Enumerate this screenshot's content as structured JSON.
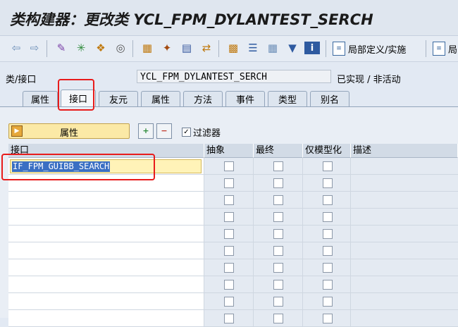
{
  "title": "类构建器：更改类 YCL_FPM_DYLANTEST_SERCH",
  "toolbar": {
    "local_def_label": "局部定义/实施",
    "local_label2": "局"
  },
  "fields": {
    "label": "类/接口",
    "value": "YCL_FPM_DYLANTEST_SERCH",
    "status": "已实现 / 非活动"
  },
  "tabs": [
    "属性",
    "接口",
    "友元",
    "属性",
    "方法",
    "事件",
    "类型",
    "别名"
  ],
  "active_tab_index": 1,
  "actions": {
    "properties_button": "属性",
    "filter_label": "过滤器",
    "filter_checked": true
  },
  "table": {
    "columns": [
      "接口",
      "抽象",
      "最终",
      "仅模型化",
      "描述"
    ],
    "rows": [
      {
        "interface": "IF_FPM_GUIBB_SEARCH",
        "abstract": false,
        "final": false,
        "modeled": false,
        "description": ""
      },
      {
        "interface": "",
        "abstract": false,
        "final": false,
        "modeled": false,
        "description": ""
      },
      {
        "interface": "",
        "abstract": false,
        "final": false,
        "modeled": false,
        "description": ""
      },
      {
        "interface": "",
        "abstract": false,
        "final": false,
        "modeled": false,
        "description": ""
      },
      {
        "interface": "",
        "abstract": false,
        "final": false,
        "modeled": false,
        "description": ""
      },
      {
        "interface": "",
        "abstract": false,
        "final": false,
        "modeled": false,
        "description": ""
      },
      {
        "interface": "",
        "abstract": false,
        "final": false,
        "modeled": false,
        "description": ""
      },
      {
        "interface": "",
        "abstract": false,
        "final": false,
        "modeled": false,
        "description": ""
      },
      {
        "interface": "",
        "abstract": false,
        "final": false,
        "modeled": false,
        "description": ""
      },
      {
        "interface": "",
        "abstract": false,
        "final": false,
        "modeled": false,
        "description": ""
      }
    ]
  },
  "colors": {
    "highlight": "#e81b1b",
    "selection": "#3a6fc3",
    "input_bg": "#fff3b8"
  }
}
